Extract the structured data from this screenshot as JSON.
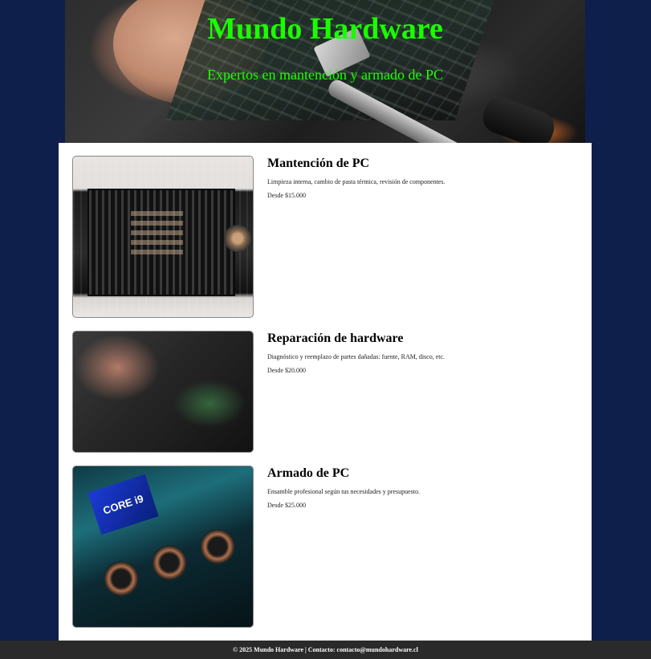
{
  "hero": {
    "title": "Mundo Hardware",
    "subtitle": "Expertos en mantención y armado de PC"
  },
  "services": [
    {
      "title": "Mantención de PC",
      "description": "Limpieza interna, cambio de pasta térmica, revisión de componentes.",
      "price": "Desde $15.000",
      "image": "pc-tower-open-case-photo"
    },
    {
      "title": "Reparación de hardware",
      "description": "Diagnóstico y reemplazo de partes dañadas: fuente, RAM, disco, etc.",
      "price": "Desde $20.000",
      "image": "hands-repairing-board-photo"
    },
    {
      "title": "Armado de PC",
      "description": "Ensamble profesional según tus necesidades y presupuesto.",
      "price": "Desde $25.000",
      "image": "gpu-and-cpu-components-photo",
      "image_text": "CORE i9"
    }
  ],
  "footer": {
    "text": "© 2025 Mundo Hardware | Contacto: contacto@mundohardware.cl"
  },
  "colors": {
    "page_background": "#0f1f4b",
    "title_color": "#1aff00",
    "content_background": "#ffffff",
    "footer_background": "#2a2a2a"
  }
}
